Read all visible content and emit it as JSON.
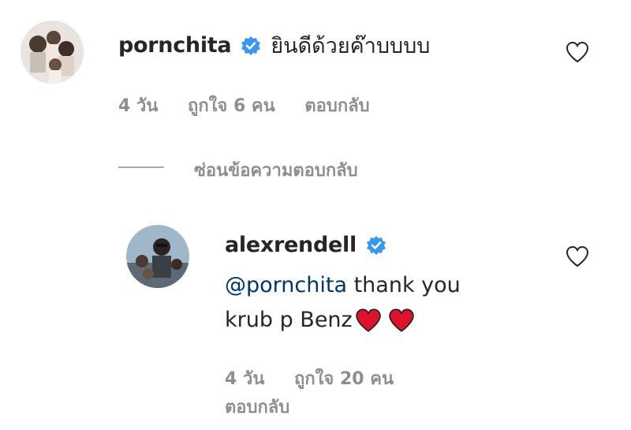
{
  "comment1": {
    "username": "pornchita",
    "text": "ยินดีด้วยค๊าบบบบ",
    "time": "4 วัน",
    "likes": "ถูกใจ 6 คน",
    "reply": "ตอบกลับ"
  },
  "hide_replies": "ซ่อนข้อความตอบกลับ",
  "comment2": {
    "username": "alexrendell",
    "mention": "@pornchita",
    "text_line1": " thank you",
    "text_line2": "krub p Benz",
    "emoji": "❤️❤️",
    "time": "4 วัน",
    "likes": "ถูกใจ 20 คน",
    "reply": "ตอบกลับ"
  },
  "colors": {
    "verified": "#3897f0",
    "mention": "#00376b",
    "meta": "#8e8e8e",
    "heart": "#e0112b"
  }
}
